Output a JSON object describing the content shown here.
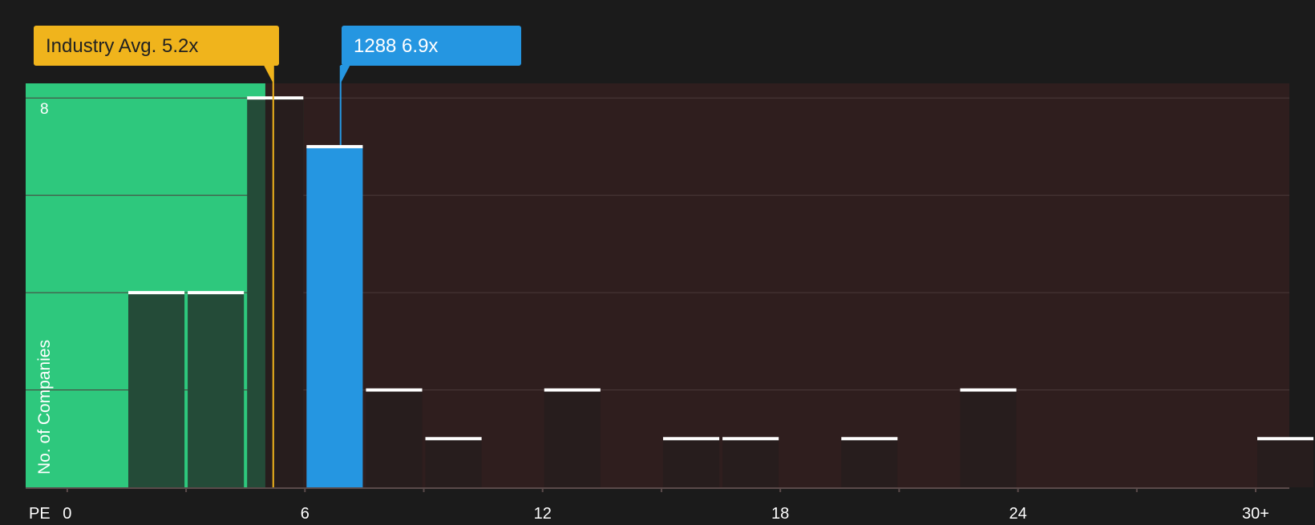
{
  "chart_data": {
    "type": "bar",
    "title": "",
    "xlabel": "PE",
    "ylabel": "No. of Companies",
    "xlim": [
      -1.05,
      30.85
    ],
    "ylim": [
      0,
      8.3
    ],
    "x_ticks": [
      {
        "value": 0,
        "label": "0"
      },
      {
        "value": 6,
        "label": "6"
      },
      {
        "value": 12,
        "label": "12"
      },
      {
        "value": 18,
        "label": "18"
      },
      {
        "value": 24,
        "label": "24"
      },
      {
        "value": 30,
        "label": "30+"
      }
    ],
    "y_tick_labels": [
      {
        "value": 8,
        "label": "8"
      }
    ],
    "y_gridlines": [
      2,
      4,
      6,
      8
    ],
    "bin_width": 1.5,
    "bars": [
      {
        "x_start": 1.5,
        "value": 4
      },
      {
        "x_start": 3.0,
        "value": 4
      },
      {
        "x_start": 4.5,
        "value": 8
      },
      {
        "x_start": 6.0,
        "value": 7,
        "highlight": true
      },
      {
        "x_start": 7.5,
        "value": 2
      },
      {
        "x_start": 9.0,
        "value": 1
      },
      {
        "x_start": 12.0,
        "value": 2
      },
      {
        "x_start": 15.0,
        "value": 1
      },
      {
        "x_start": 16.5,
        "value": 1
      },
      {
        "x_start": 19.5,
        "value": 1
      },
      {
        "x_start": 22.5,
        "value": 2
      },
      {
        "x_start": 30.0,
        "value": 1
      }
    ],
    "fair_range": [
      -1.05,
      5.0
    ],
    "annotations": [
      {
        "label": "Industry Avg. 5.2x",
        "value": 5.2,
        "color": "#f0b41c",
        "text_color": "#222222"
      },
      {
        "label": "1288 6.9x",
        "value": 6.9,
        "color": "#2596e1",
        "text_color": "#ffffff"
      }
    ],
    "colors": {
      "background": "#1b1b1b",
      "plot_bg": "#2f1e1e",
      "fair_zone": "#2ec87d",
      "bar_default": "#271d1d",
      "bar_in_fair": "#244b38",
      "bar_highlight": "#2596e1",
      "bar_cap": "#ffffff",
      "grid": "#4b3a3a",
      "axis": "#5a4a4a",
      "tick_text": "#ffffff"
    }
  }
}
